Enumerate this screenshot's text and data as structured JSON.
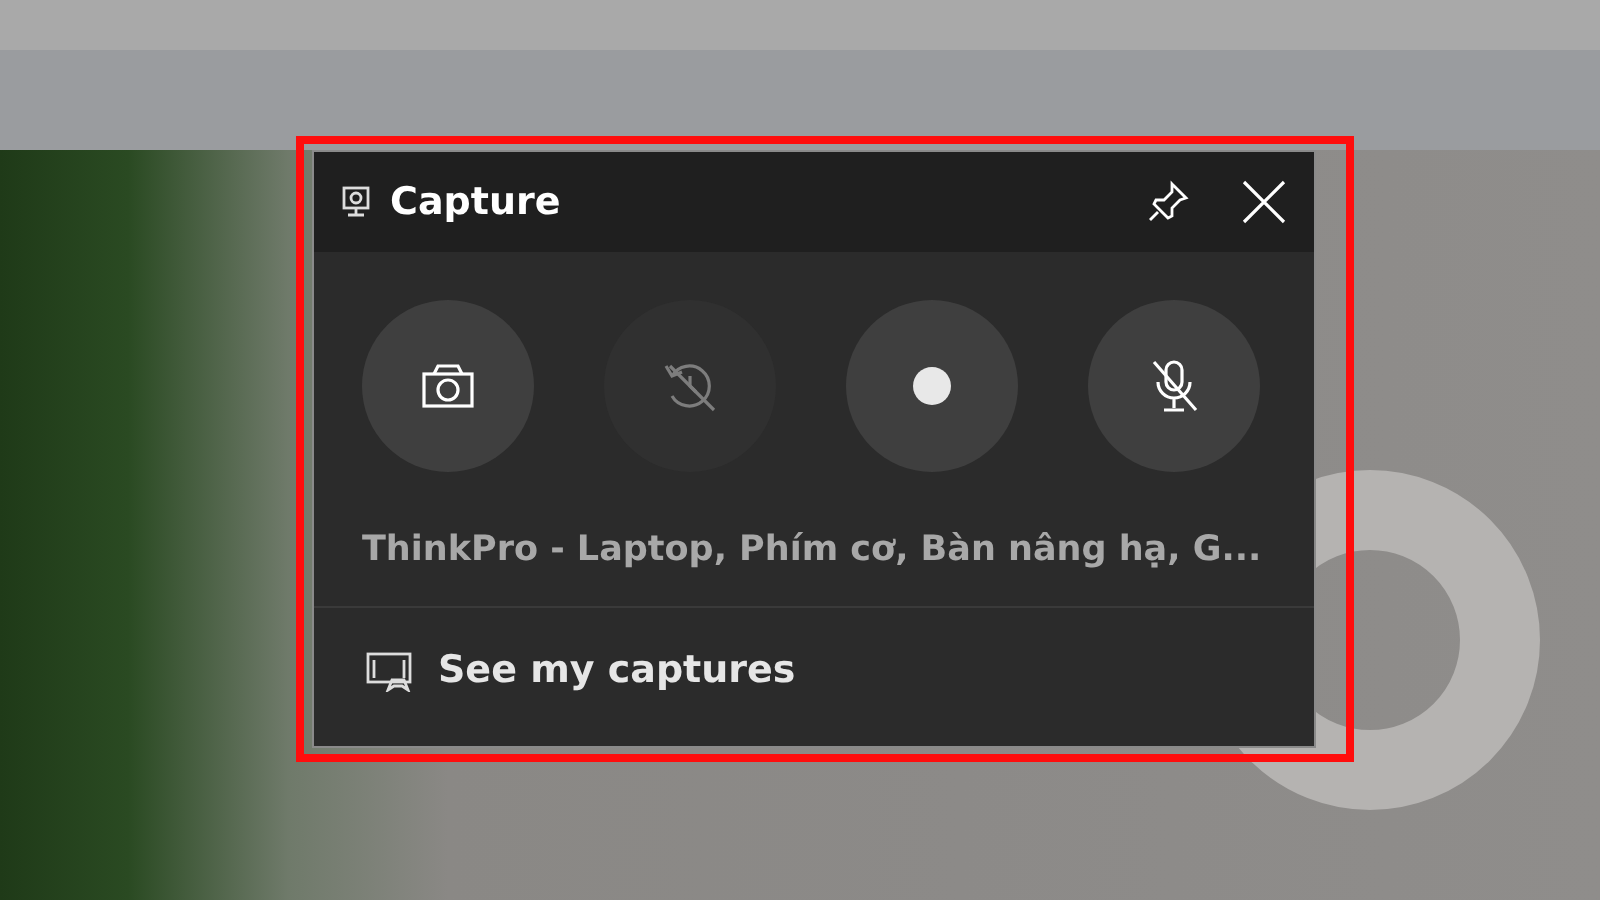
{
  "panel": {
    "title": "Capture",
    "pinned": false,
    "buttons": [
      {
        "kind": "screenshot",
        "disabled": false
      },
      {
        "kind": "record-last",
        "disabled": true
      },
      {
        "kind": "record",
        "disabled": false
      },
      {
        "kind": "mic",
        "disabled": false,
        "muted": true
      }
    ],
    "target_window": "ThinkPro - Laptop, Phím cơ, Bàn nâng hạ, G...",
    "footer_link": "See my captures"
  }
}
